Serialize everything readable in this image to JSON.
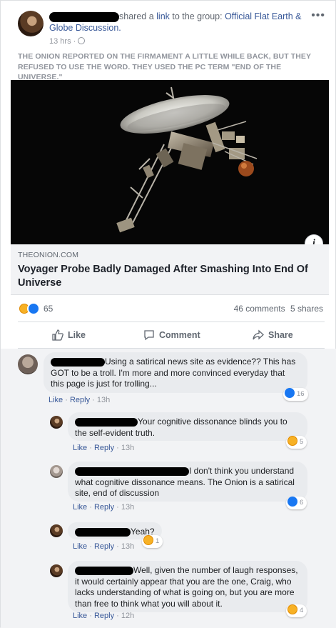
{
  "post": {
    "action_text": "shared a",
    "link_word": "link",
    "to_the_group": "to the group:",
    "group_name": "Official Flat Earth & Globe Discussion.",
    "time": "13 hrs ·",
    "body": "THE ONION REPORTED ON THE FIRMAMENT A LITTLE WHILE BACK, BUT THEY REFUSED TO USE THE WORD. THEY USED THE PC TERM \"END OF THE UNIVERSE.\"",
    "more_label": "•••",
    "info_label": "i"
  },
  "link_preview": {
    "domain": "THEONION.COM",
    "title": "Voyager Probe Badly Damaged After Smashing Into End Of Universe"
  },
  "reactions": {
    "count": "65",
    "comments": "46 comments",
    "shares": "5 shares"
  },
  "actions": {
    "like": "Like",
    "comment": "Comment",
    "share": "Share"
  },
  "comments": [
    {
      "text": "Using a satirical news site as evidence?? This has GOT to be a troll. I'm more and more convinced everyday that this page is just for trolling...",
      "like": "Like",
      "reply": "Reply",
      "time": "13h",
      "reaction_count": "16",
      "reaction_type": "like"
    },
    {
      "text": "Your cognitive dissonance blinds you to the self-evident truth.",
      "like": "Like",
      "reply": "Reply",
      "time": "13h",
      "reaction_count": "5",
      "reaction_type": "haha"
    },
    {
      "text": "I don't think you understand what cognitive dissonance means. The Onion is a satirical site, end of discussion",
      "like": "Like",
      "reply": "Reply",
      "time": "13h",
      "reaction_count": "6",
      "reaction_type": "like"
    },
    {
      "text": "Yeah?",
      "like": "Like",
      "reply": "Reply",
      "time": "13h",
      "reaction_count": "1",
      "reaction_type": "haha"
    },
    {
      "text": "Well, given the number of laugh responses, it would certainly appear that you are the one, Craig, who lacks understanding of what is going on, but you are more than free to think what you will about it.",
      "like": "Like",
      "reply": "Reply",
      "time": "12h",
      "reaction_count": "4",
      "reaction_type": "haha"
    }
  ],
  "colors": {
    "link": "#385898",
    "like_blue": "#1877f2",
    "haha_yellow": "#f7b125",
    "muted": "#90949c"
  }
}
